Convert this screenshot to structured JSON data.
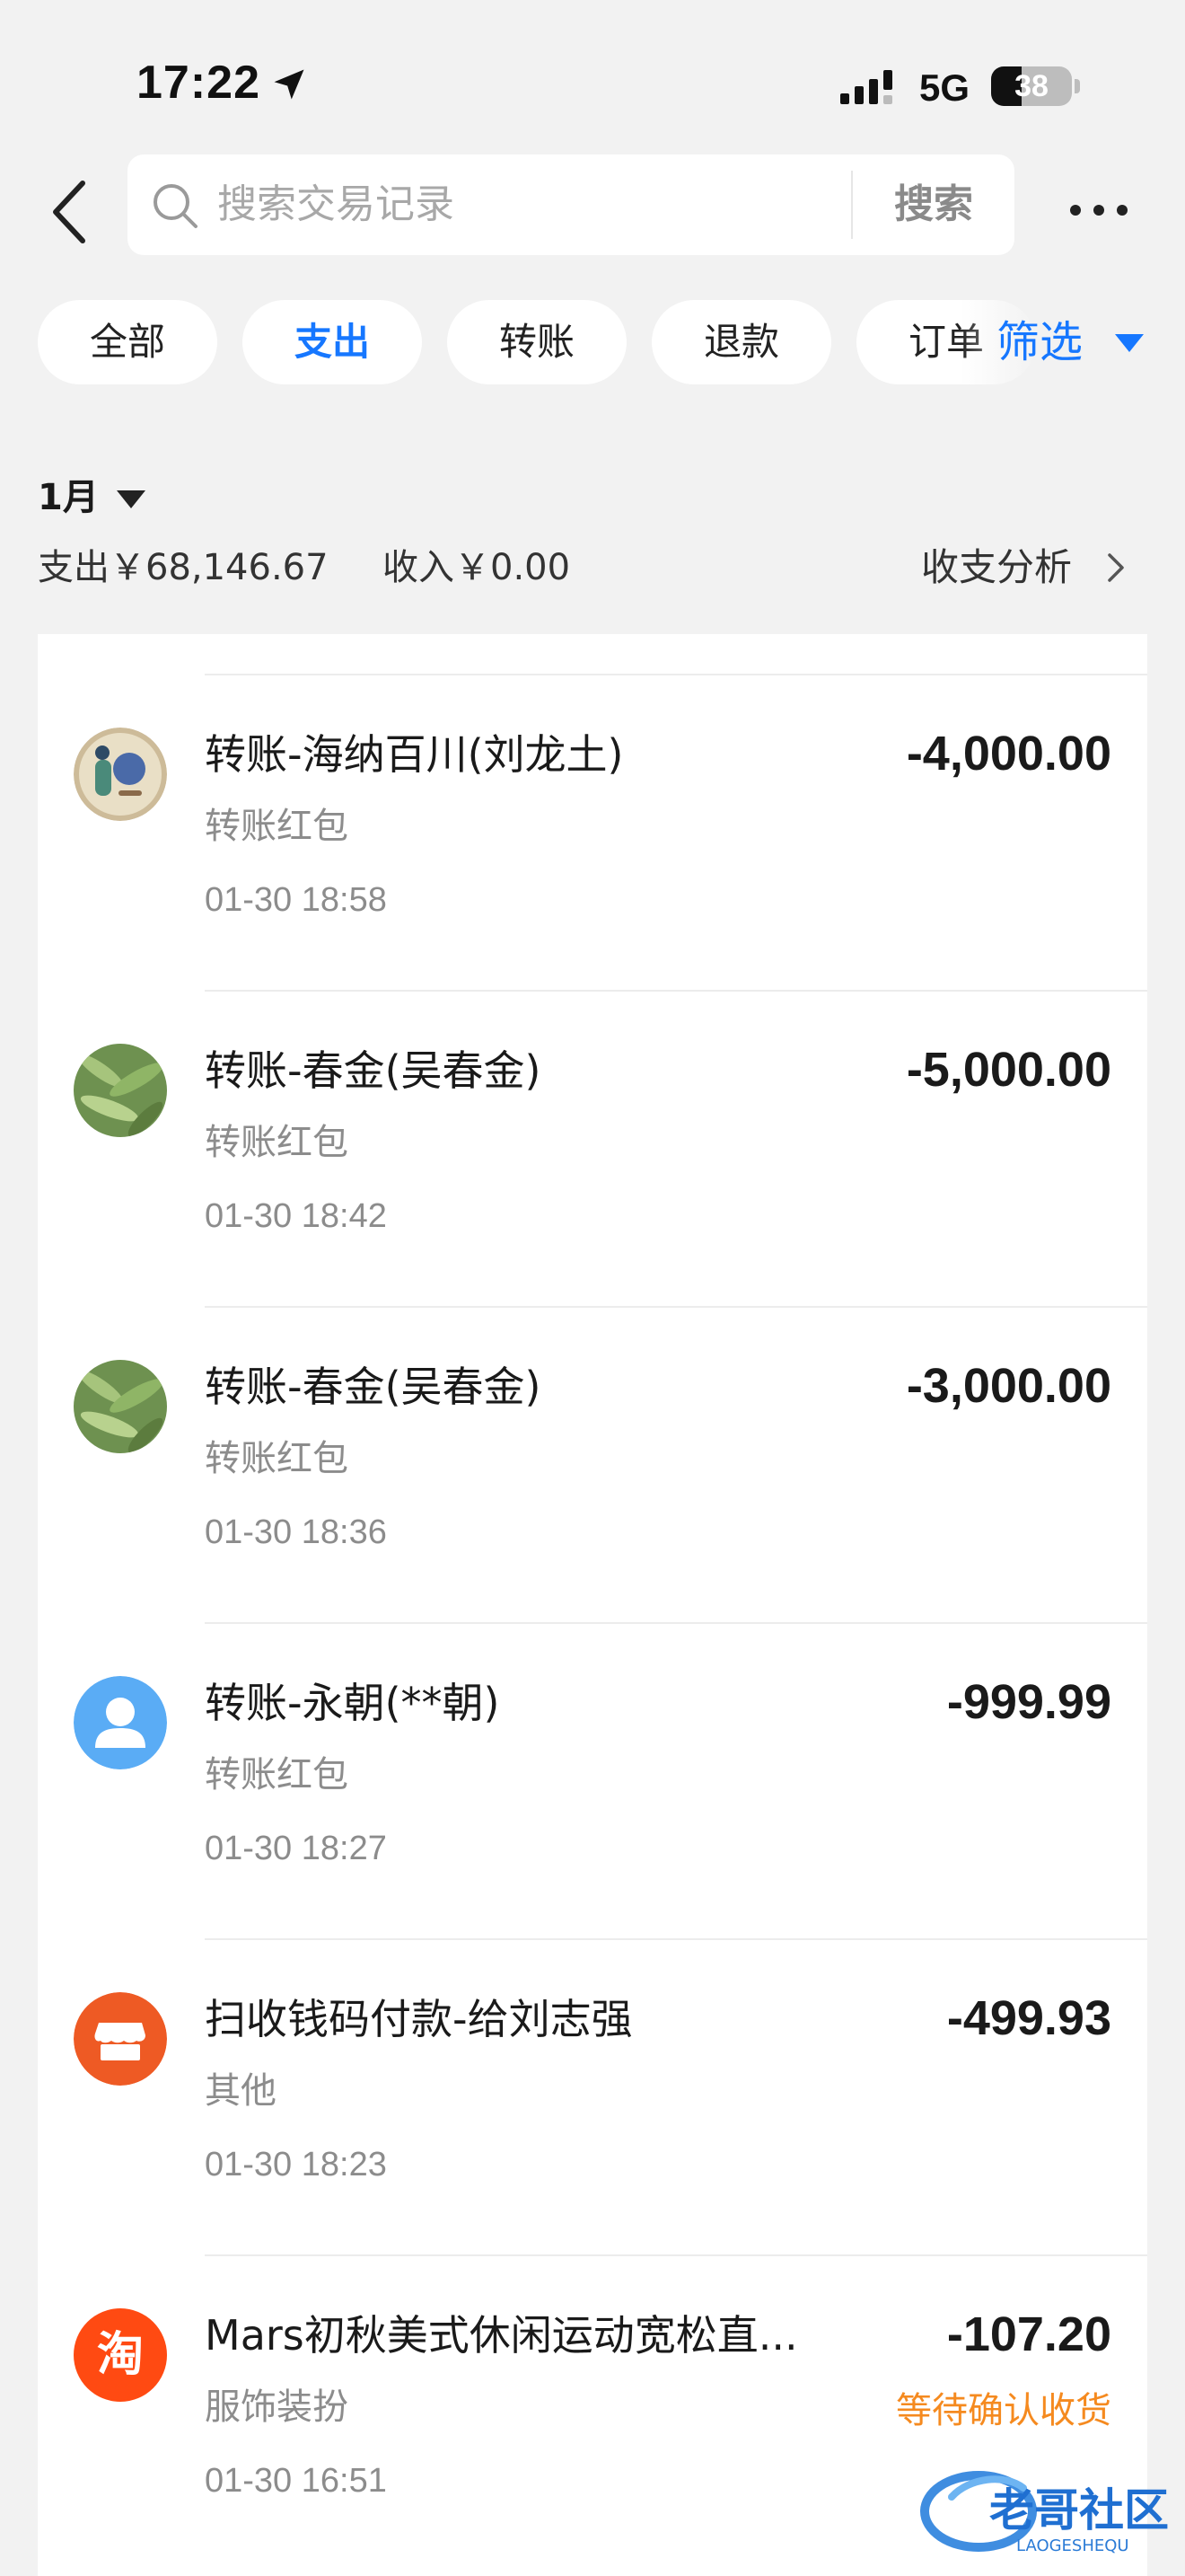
{
  "status_bar": {
    "time": "17:22",
    "network": "5G",
    "battery": "38"
  },
  "header": {
    "search_placeholder": "搜索交易记录",
    "search_button": "搜索"
  },
  "tabs": [
    {
      "label": "全部",
      "active": false
    },
    {
      "label": "支出",
      "active": true
    },
    {
      "label": "转账",
      "active": false
    },
    {
      "label": "退款",
      "active": false
    },
    {
      "label": "订单",
      "active": false
    }
  ],
  "filter_label": "筛选",
  "summary": {
    "month": "1月",
    "expense": "支出￥68,146.67",
    "income": "收入￥0.00",
    "analysis": "收支分析"
  },
  "transactions": [
    {
      "title": "转账-海纳百川(刘龙土)",
      "category": "转账红包",
      "time": "01-30 18:58",
      "amount": "-4,000.00",
      "avatar": "photo-avatar-icon"
    },
    {
      "title": "转账-春金(吴春金)",
      "category": "转账红包",
      "time": "01-30 18:42",
      "amount": "-5,000.00",
      "avatar": "leaf-avatar-icon"
    },
    {
      "title": "转账-春金(吴春金)",
      "category": "转账红包",
      "time": "01-30 18:36",
      "amount": "-3,000.00",
      "avatar": "leaf-avatar-icon"
    },
    {
      "title": "转账-永朝(**朝)",
      "category": "转账红包",
      "time": "01-30 18:27",
      "amount": "-999.99",
      "avatar": "default-user-avatar-icon"
    },
    {
      "title": "扫收钱码付款-给刘志强",
      "category": "其他",
      "time": "01-30 18:23",
      "amount": "-499.93",
      "avatar": "store-icon"
    },
    {
      "title": "Mars初秋美式休闲运动宽松直...",
      "category": "服饰装扮",
      "time": "01-30 16:51",
      "amount": "-107.20",
      "status": "等待确认收货",
      "avatar": "taobao-icon",
      "avatar_text": "淘"
    }
  ],
  "watermark": {
    "text": "老哥社区",
    "subtext": "LAOGESHEQU"
  },
  "colors": {
    "accent": "#1677ff",
    "background": "#f2f2f2",
    "status_orange": "#f58a1f",
    "store_orange": "#ee5a24",
    "taobao_orange": "#ff4a12",
    "default_avatar_blue": "#5aacf5"
  }
}
